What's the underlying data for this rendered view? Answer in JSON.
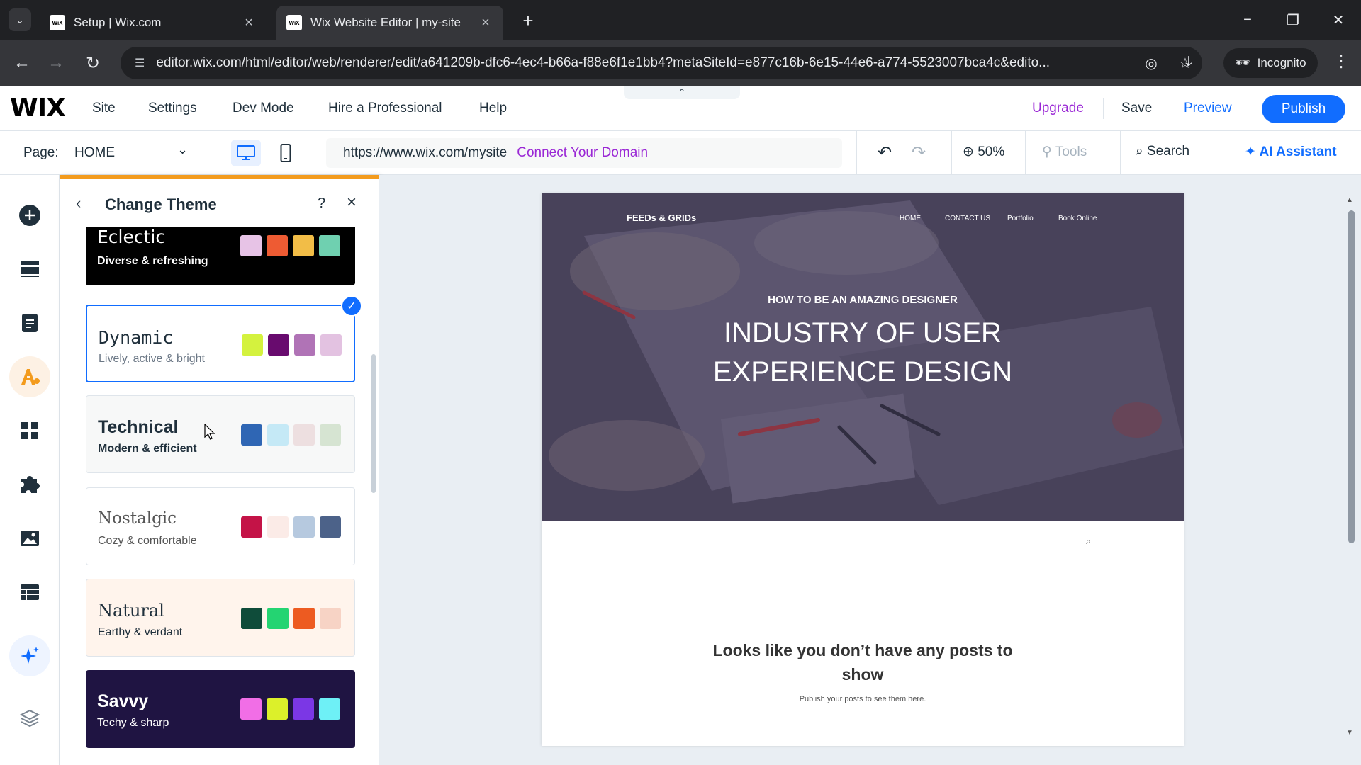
{
  "browser": {
    "tabs": [
      {
        "title": "Setup | Wix.com",
        "favicon": "WiX"
      },
      {
        "title": "Wix Website Editor | my-site",
        "favicon": "WiX"
      }
    ],
    "url": "editor.wix.com/html/editor/web/renderer/edit/a641209b-dfc6-4ec4-b66a-f88e6f1e1bb4?metaSiteId=e877c16b-6e15-44e6-a774-5523007bca4c&edito...",
    "incognito_label": "Incognito"
  },
  "topbar": {
    "logo": "WIX",
    "menu": [
      "Site",
      "Settings",
      "Dev Mode",
      "Hire a Professional",
      "Help"
    ],
    "upgrade": "Upgrade",
    "save": "Save",
    "preview": "Preview",
    "publish": "Publish"
  },
  "pagebar": {
    "page_label": "Page:",
    "page_value": "HOME",
    "site_url": "https://www.wix.com/mysite",
    "connect_domain": "Connect Your Domain",
    "zoom": "50%",
    "tools": "Tools",
    "search": "Search",
    "ai_assistant": "AI Assistant"
  },
  "panel": {
    "title": "Change Theme",
    "themes": [
      {
        "name": "Eclectic",
        "desc": "Diverse & refreshing",
        "colors": [
          "#e7c3e6",
          "#ee5b33",
          "#f2bd47",
          "#6fd0b0"
        ]
      },
      {
        "name": "Dynamic",
        "desc": "Lively, active & bright",
        "colors": [
          "#d4f23e",
          "#680b6e",
          "#b073b6",
          "#e3c2e1"
        ],
        "selected": true
      },
      {
        "name": "Technical",
        "desc": "Modern & efficient",
        "colors": [
          "#2f66b4",
          "#c5e9f6",
          "#eddfe0",
          "#d6e4d2"
        ]
      },
      {
        "name": "Nostalgic",
        "desc": "Cozy & comfortable",
        "colors": [
          "#c41347",
          "#fbebe7",
          "#b6c9df",
          "#4c6289"
        ]
      },
      {
        "name": "Natural",
        "desc": "Earthy & verdant",
        "colors": [
          "#0f4c3a",
          "#24d472",
          "#ed5b21",
          "#f7d3c5"
        ]
      },
      {
        "name": "Savvy",
        "desc": "Techy & sharp",
        "colors": [
          "#f16ee6",
          "#dcf02a",
          "#7b37e5",
          "#6ef0f6"
        ]
      }
    ]
  },
  "site": {
    "logo": "FEEDs & GRIDs",
    "nav": [
      "HOME",
      "CONTACT US",
      "Portfolio",
      "Book Online"
    ],
    "kicker": "HOW TO BE AN AMAZING DESIGNER",
    "title_line1": "INDUSTRY OF USER",
    "title_line2": "EXPERIENCE DESIGN",
    "empty_line1": "Looks like you don’t have any posts to",
    "empty_line2": "show",
    "empty_sub": "Publish your posts to see them here."
  },
  "colors": {
    "wix_blue": "#116dff",
    "upgrade_purple": "#9a27d5",
    "panel_accent": "#f39b1d"
  }
}
